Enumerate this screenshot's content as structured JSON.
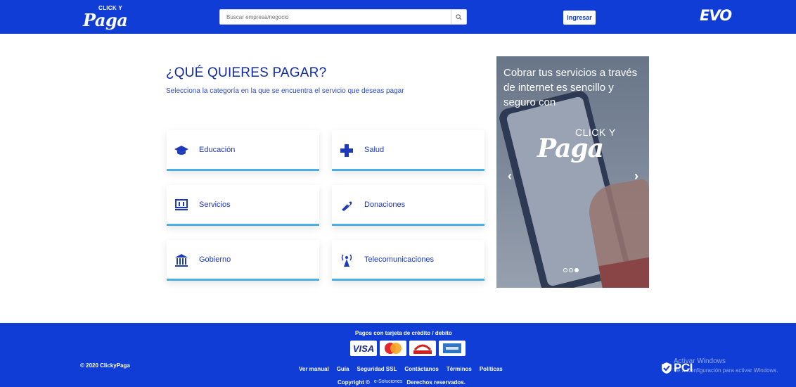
{
  "header": {
    "logo_small": "CLICK Y",
    "logo_big": "Paga",
    "search_placeholder": "Buscar empresa/negocio",
    "login_label": "Ingresar",
    "partner_logo": "EVO"
  },
  "main": {
    "title": "¿QUÉ QUIERES PAGAR?",
    "subtitle": "Selecciona la categoría en la que se encuentra el servicio que deseas pagar",
    "categories": [
      {
        "label": "Educación",
        "icon": "graduation-cap-icon"
      },
      {
        "label": "Salud",
        "icon": "medical-cross-icon"
      },
      {
        "label": "Servicios",
        "icon": "monitor-icon"
      },
      {
        "label": "Donaciones",
        "icon": "hand-donation-icon"
      },
      {
        "label": "Gobierno",
        "icon": "government-building-icon"
      },
      {
        "label": "Telecomunicaciones",
        "icon": "antenna-icon"
      }
    ]
  },
  "carousel": {
    "text": "Cobrar tus servicios a través de internet es sencillo y seguro con",
    "logo_small": "CLICK Y",
    "logo_big": "Paga",
    "prev": "‹",
    "next": "›",
    "slides": 3,
    "active_slide": 3
  },
  "footer": {
    "copyright_year": "© 2020 ClickyPaga",
    "payment_title": "Pagos con tarjeta de crédito / debito",
    "card_brands": [
      "VISA",
      "MasterCard",
      "CARNET",
      "American Express"
    ],
    "links": [
      "Ver manual",
      "Guía",
      "Seguridad SSL",
      "Contáctanos",
      "Términos",
      "Políticas"
    ],
    "copyright_label": "Copyright ©",
    "esoluciones": "e-Soluciones",
    "rights": "Derechos reservados.",
    "pci_label": "PCI"
  },
  "windows_overlay": {
    "line1": "Activar Windows",
    "line2": "Ve a Configuración para activar Windows."
  },
  "colors": {
    "brand_blue": "#0f3dd6",
    "accent_light_blue": "#4aaee8",
    "text_blue": "#1d3ab8"
  }
}
